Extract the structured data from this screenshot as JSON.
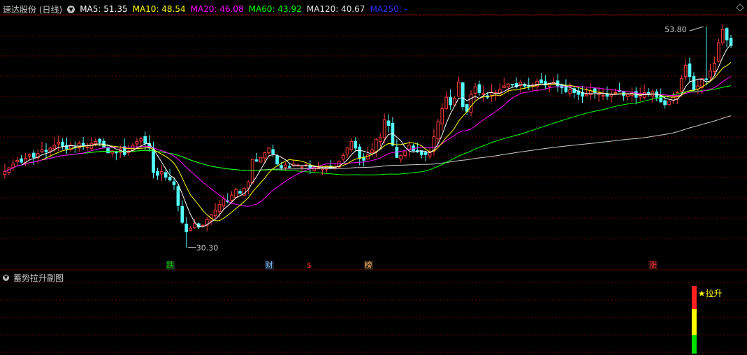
{
  "header": {
    "stock_name": "速达股份 (日线)",
    "indicators": [
      {
        "label": "MA5: 51.35",
        "color": "#ffffff"
      },
      {
        "label": "MA10: 48.54",
        "color": "#ffff00"
      },
      {
        "label": "MA20: 46.08",
        "color": "#ff00ff"
      },
      {
        "label": "MA60: 43.92",
        "color": "#00ff00"
      },
      {
        "label": "MA120: 40.67",
        "color": "#e0e0e0"
      },
      {
        "label": "MA250: -",
        "color": "#3030ff"
      }
    ]
  },
  "sub_panel": {
    "title": "蓄势拉升副图",
    "signal_label": "★拉升"
  },
  "event_tags": [
    {
      "text": "跌",
      "color": "#00cc00",
      "bg": "#1a2a1a",
      "index": 40
    },
    {
      "text": "财",
      "color": "#7fbfff",
      "bg": "#1a1f2a",
      "index": 64
    },
    {
      "text": "$",
      "color": "#ff3030",
      "bg": "#000000",
      "index": 74
    },
    {
      "text": "榜",
      "color": "#ffb070",
      "bg": "#2a1f10",
      "index": 88
    },
    {
      "text": "涨",
      "color": "#ff3030",
      "bg": "#2a1010",
      "index": 157
    }
  ],
  "colors": {
    "up": "#ff3c3c",
    "down": "#54ffff",
    "ma5": "#ffffff",
    "ma10": "#ffff00",
    "ma20": "#ff00ff",
    "ma60": "#00ff00",
    "ma120": "#cccccc",
    "grid": "#7a0000"
  },
  "chart_data": {
    "type": "candlestick",
    "title": "速达股份 (日线)",
    "ylim": [
      29.3,
      55.0
    ],
    "annotations": [
      {
        "label": "53.80",
        "type": "high",
        "index": 170,
        "value": 53.8
      },
      {
        "label": "30.30",
        "type": "low",
        "index": 44,
        "value": 30.3
      }
    ],
    "ma_last": {
      "MA5": 51.35,
      "MA10": 48.54,
      "MA20": 46.08,
      "MA60": 43.92,
      "MA120": 40.67
    },
    "closes": [
      38.4,
      38.8,
      39.2,
      39.6,
      39.4,
      39.8,
      40.2,
      39.9,
      40.3,
      40.7,
      40.5,
      40.9,
      41.2,
      41.5,
      41.1,
      40.8,
      41.2,
      41.0,
      41.4,
      41.2,
      41.0,
      41.4,
      41.6,
      41.5,
      41.0,
      40.4,
      40.6,
      40.4,
      40.8,
      40.2,
      40.6,
      41.2,
      41.6,
      41.9,
      41.4,
      40.9,
      38.3,
      38.0,
      38.4,
      37.8,
      37.5,
      37.0,
      34.8,
      33.0,
      32.0,
      32.4,
      32.9,
      32.5,
      32.7,
      33.3,
      33.8,
      34.3,
      34.9,
      35.5,
      35.2,
      35.9,
      36.5,
      36.1,
      36.6,
      37.3,
      39.7,
      39.5,
      39.9,
      40.4,
      40.9,
      40.3,
      39.2,
      38.8,
      39.1,
      38.9,
      39.2,
      39.1,
      38.9,
      39.1,
      38.7,
      38.9,
      38.8,
      38.7,
      39.0,
      38.8,
      38.9,
      39.5,
      40.1,
      40.9,
      41.6,
      40.9,
      39.8,
      39.6,
      40.2,
      40.7,
      41.8,
      42.0,
      43.9,
      43.3,
      41.2,
      39.9,
      40.1,
      40.5,
      41.2,
      40.6,
      40.5,
      40.2,
      40.2,
      40.5,
      42.1,
      43.7,
      45.1,
      46.3,
      45.5,
      46.2,
      47.9,
      45.3,
      44.8,
      46.6,
      47.4,
      46.8,
      46.7,
      46.3,
      46.8,
      46.8,
      47.1,
      47.5,
      47.7,
      47.6,
      47.4,
      47.9,
      47.5,
      47.4,
      47.6,
      48.0,
      47.8,
      47.6,
      47.8,
      47.9,
      47.5,
      47.3,
      46.9,
      47.1,
      46.8,
      46.6,
      46.4,
      46.6,
      47.0,
      46.8,
      46.7,
      46.5,
      46.4,
      46.6,
      46.8,
      46.9,
      46.5,
      46.6,
      46.7,
      46.3,
      46.5,
      46.8,
      46.6,
      46.9,
      46.3,
      45.8,
      45.5,
      45.9,
      46.4,
      46.8,
      48.3,
      49.7,
      48.5,
      47.1,
      47.5,
      48.3,
      48.2,
      49.1,
      49.9,
      52.1,
      53.5,
      52.4,
      51.8
    ]
  }
}
